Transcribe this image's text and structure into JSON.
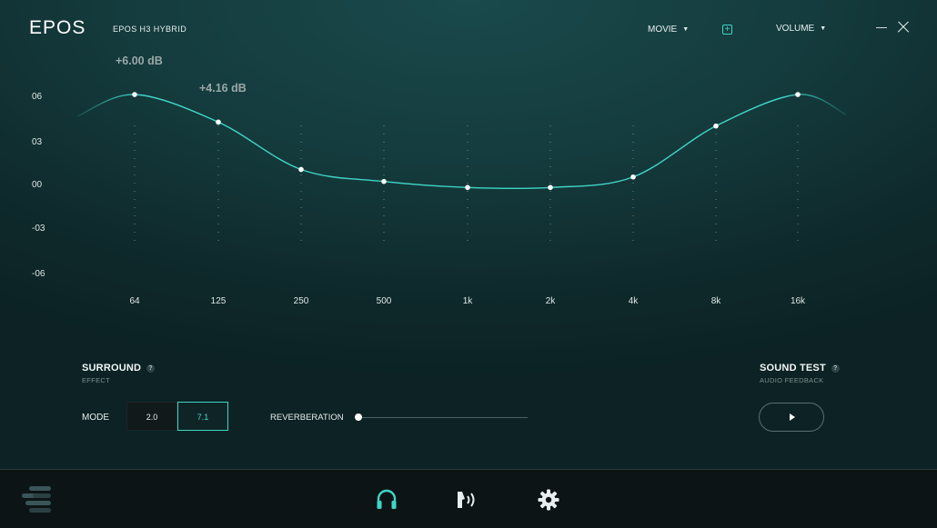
{
  "header": {
    "logo": "EPOS",
    "device_name": "EPOS H3 HYBRID",
    "preset_label": "MOVIE",
    "volume_label": "VOLUME",
    "add_preset_glyph": "+"
  },
  "equalizer": {
    "y_axis_labels": [
      "06",
      "03",
      "00",
      "-03",
      "-06"
    ],
    "frequency_labels": [
      "64",
      "125",
      "250",
      "500",
      "1k",
      "2k",
      "4k",
      "8k",
      "16k"
    ],
    "band_gains_db": [
      6.0,
      4.16,
      1.0,
      0.2,
      -0.2,
      -0.2,
      0.5,
      3.9,
      6.0
    ],
    "y_range_db": [
      -6,
      6
    ],
    "annotations": {
      "band_64": "+6.00 dB",
      "band_125": "+4.16 dB"
    },
    "curve_color": "#3fd6c6"
  },
  "surround": {
    "title": "SURROUND",
    "subtitle": "EFFECT",
    "help_glyph": "?",
    "mode_label": "MODE",
    "modes": [
      "2.0",
      "7.1"
    ],
    "selected_mode": "7.1",
    "reverberation_label": "REVERBERATION",
    "reverberation_level": 0
  },
  "sound_test": {
    "title": "SOUND TEST",
    "subtitle": "AUDIO FEEDBACK",
    "help_glyph": "?"
  },
  "bottom_nav": {
    "active_item": "headphones",
    "items": [
      "menu-icon",
      "headphones-icon",
      "voice-icon",
      "gear-icon"
    ]
  },
  "colors": {
    "accent": "#3fd6c6",
    "background": "#143a3c",
    "bottom_bar": "#0d1416"
  }
}
